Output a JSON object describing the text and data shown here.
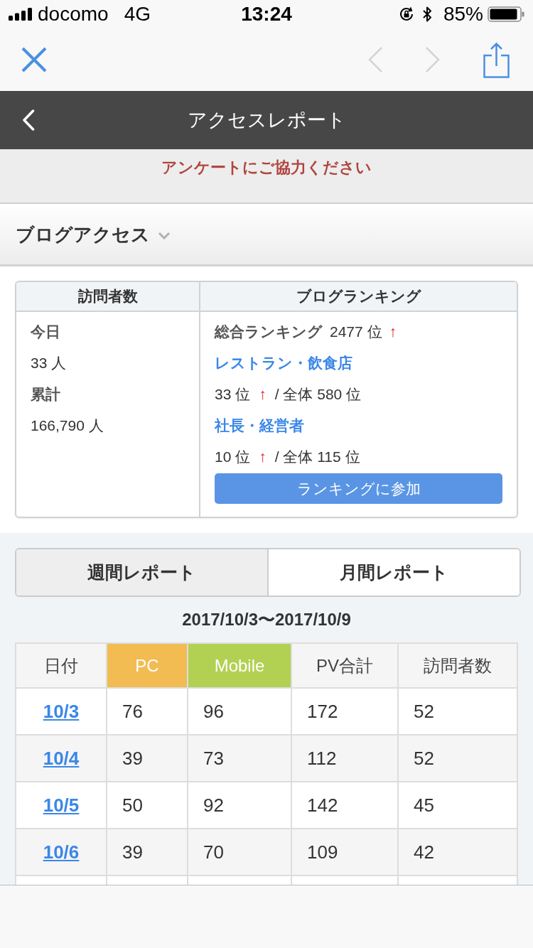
{
  "status_bar": {
    "carrier": "docomo",
    "network": "4G",
    "time": "13:24",
    "battery": "85%"
  },
  "browser_toolbar": {
    "nav": [
      {
        "kind": "back",
        "disabled": true
      },
      {
        "kind": "forward",
        "disabled": true
      }
    ]
  },
  "header": {
    "title": "アクセスレポート"
  },
  "survey_banner": {
    "text": "アンケートにご協力ください"
  },
  "section": {
    "title": "ブログアクセス"
  },
  "summary": {
    "columns": [
      "訪問者数",
      "ブログランキング"
    ],
    "visitors": [
      {
        "kind": "label",
        "text": "今日"
      },
      {
        "kind": "value",
        "text": "33 人"
      },
      {
        "kind": "label",
        "text": "累計"
      },
      {
        "kind": "value",
        "text": "166,790 人"
      }
    ],
    "ranking": {
      "overall": {
        "label": "総合ランキング",
        "rank": "2477 位",
        "trend": "↑"
      },
      "categories": [
        {
          "name": "レストラン・飲食店",
          "rank": "33 位",
          "trend": "↑",
          "total": "/ 全体 580 位"
        },
        {
          "name": "社長・経営者",
          "rank": "10 位",
          "trend": "↑",
          "total": "/ 全体 115 位"
        }
      ],
      "join_button": "ランキングに参加"
    }
  },
  "tabs": [
    {
      "label": "週間レポート",
      "selected": true
    },
    {
      "label": "月間レポート",
      "selected": false
    }
  ],
  "date_range": "2017/10/3〜2017/10/9",
  "table": {
    "columns": [
      {
        "label": "日付",
        "kind": "link"
      },
      {
        "label": "PC",
        "kind": "number",
        "color": "#f2bc52"
      },
      {
        "label": "Mobile",
        "kind": "number",
        "color": "#b2d152"
      },
      {
        "label": "PV合計",
        "kind": "number"
      },
      {
        "label": "訪問者数",
        "kind": "number"
      }
    ],
    "rows": [
      [
        "10/3",
        "76",
        "96",
        "172",
        "52"
      ],
      [
        "10/4",
        "39",
        "73",
        "112",
        "52"
      ],
      [
        "10/5",
        "50",
        "92",
        "142",
        "45"
      ],
      [
        "10/6",
        "39",
        "70",
        "109",
        "42"
      ]
    ]
  }
}
